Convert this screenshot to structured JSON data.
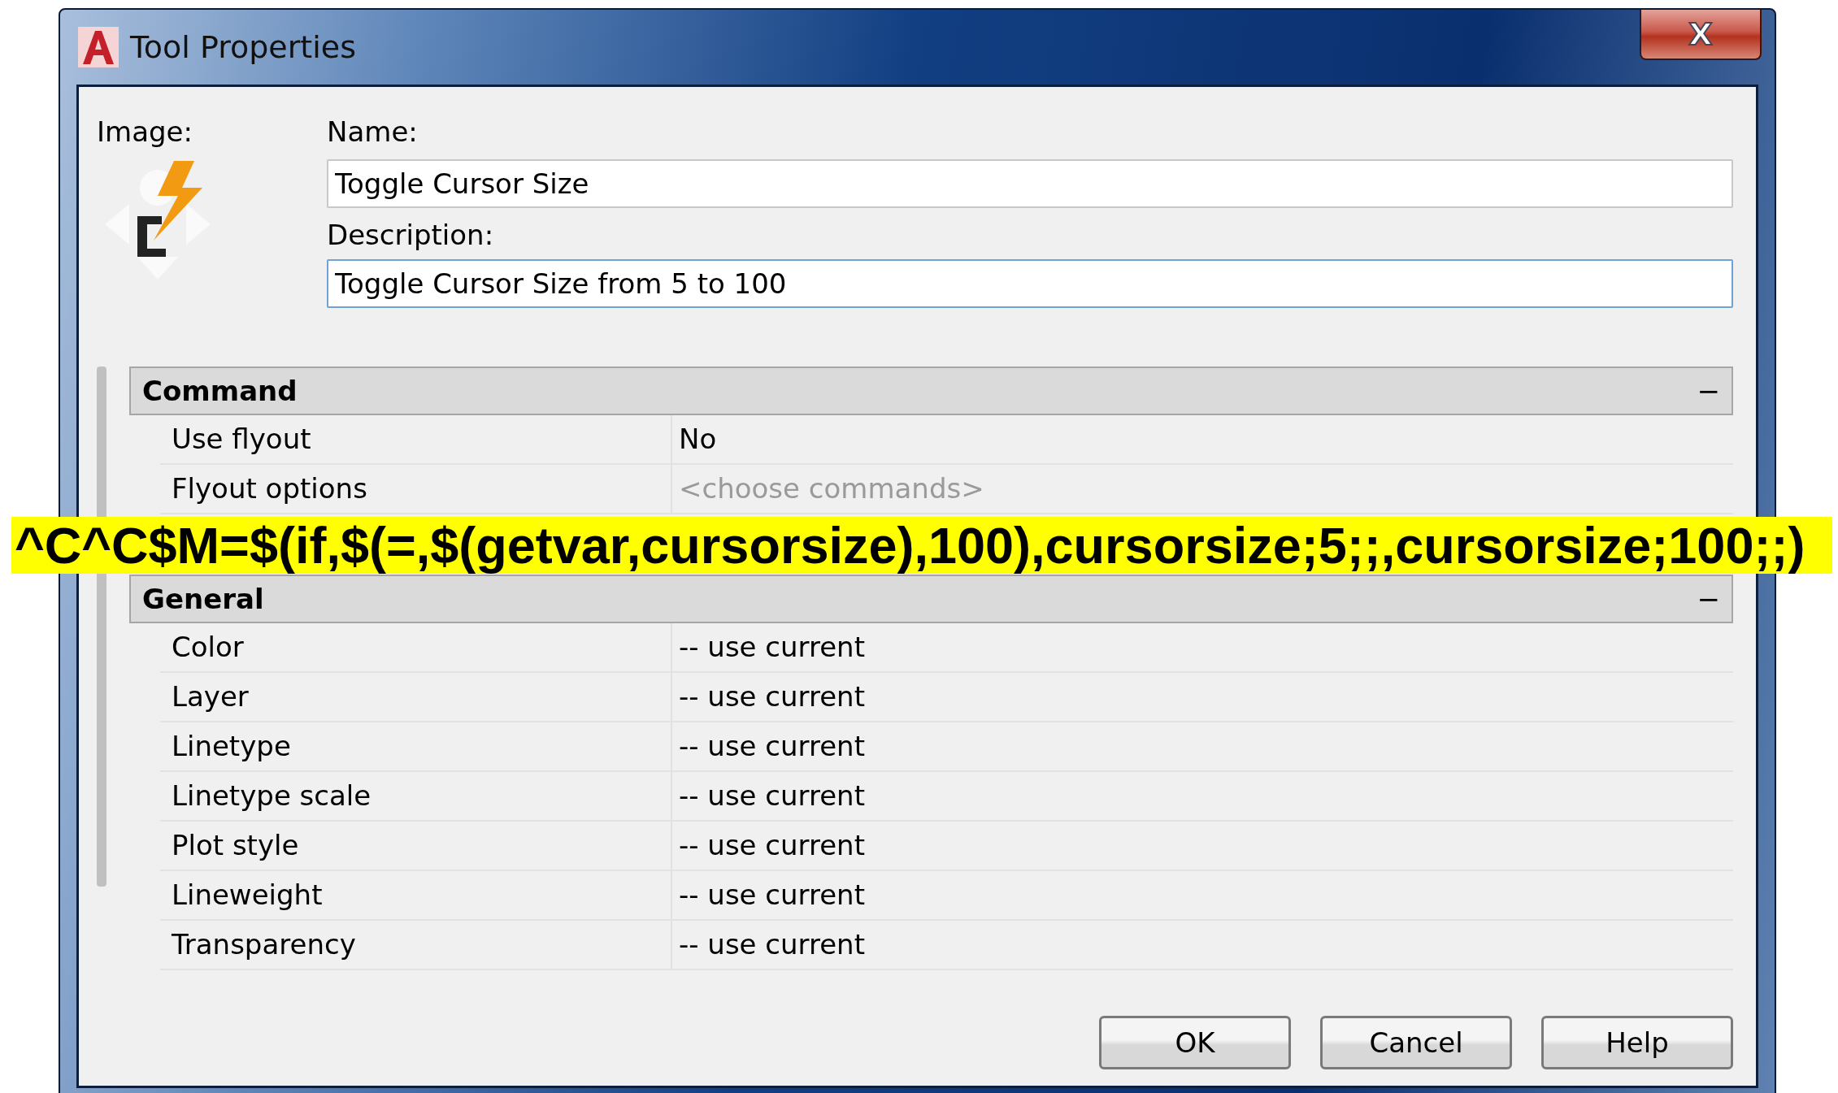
{
  "window": {
    "title": "Tool Properties",
    "close": "X"
  },
  "image_label": "Image:",
  "name": {
    "label": "Name:",
    "value": "Toggle Cursor Size"
  },
  "description": {
    "label": "Description:",
    "value": "Toggle Cursor Size from 5 to 100"
  },
  "sections": [
    {
      "title": "Command",
      "toggle": "−",
      "rows": [
        {
          "label": "Use flyout",
          "value": "No",
          "disabled": false
        },
        {
          "label": "Flyout options",
          "value": "<choose commands>",
          "disabled": true
        }
      ]
    },
    {
      "title": "General",
      "toggle": "−",
      "rows": [
        {
          "label": "Color",
          "value": "-- use current",
          "disabled": false
        },
        {
          "label": "Layer",
          "value": "-- use current",
          "disabled": false
        },
        {
          "label": "Linetype",
          "value": "-- use current",
          "disabled": false
        },
        {
          "label": "Linetype scale",
          "value": "-- use current",
          "disabled": false
        },
        {
          "label": "Plot style",
          "value": "-- use current",
          "disabled": false
        },
        {
          "label": "Lineweight",
          "value": "-- use current",
          "disabled": false
        },
        {
          "label": "Transparency",
          "value": "-- use current",
          "disabled": false
        }
      ]
    }
  ],
  "annotation": "^C^C$M=$(if,$(=,$(getvar,cursorsize),100),cursorsize;5;;,cursorsize;100;;)",
  "buttons": [
    "OK",
    "Cancel",
    "Help"
  ]
}
